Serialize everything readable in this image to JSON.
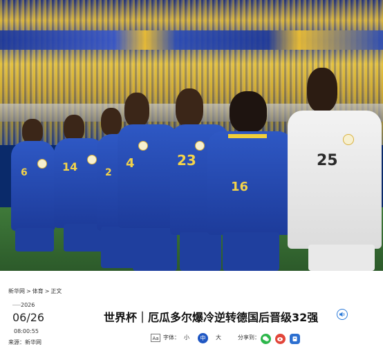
{
  "breadcrumb": {
    "site": "新华网",
    "section": "体育",
    "page": "正文",
    "sep": ">"
  },
  "date": {
    "year": "2026",
    "month_day": "06/26",
    "time": "08:00:55",
    "source": "来源：新华网"
  },
  "article": {
    "title": "世界杯｜厄瓜多尔爆冷逆转德国后晋级32强"
  },
  "toolbar": {
    "font_label": "字体：",
    "font_icon_text": "Aa",
    "font_small": "小",
    "font_medium": "中",
    "font_large": "大",
    "share_label": "分享到："
  },
  "photo": {
    "numbers": [
      "6",
      "14",
      "2",
      "4",
      "23",
      "16",
      "25"
    ]
  },
  "colors": {
    "accent": "#1f57c3",
    "wechat": "#2cb64a",
    "weibo": "#e2463a",
    "qq": "#2c6fd0"
  },
  "icons": {
    "audio": "speaker-icon",
    "wechat": "wechat-icon",
    "weibo": "weibo-icon",
    "qq": "qq-icon"
  }
}
